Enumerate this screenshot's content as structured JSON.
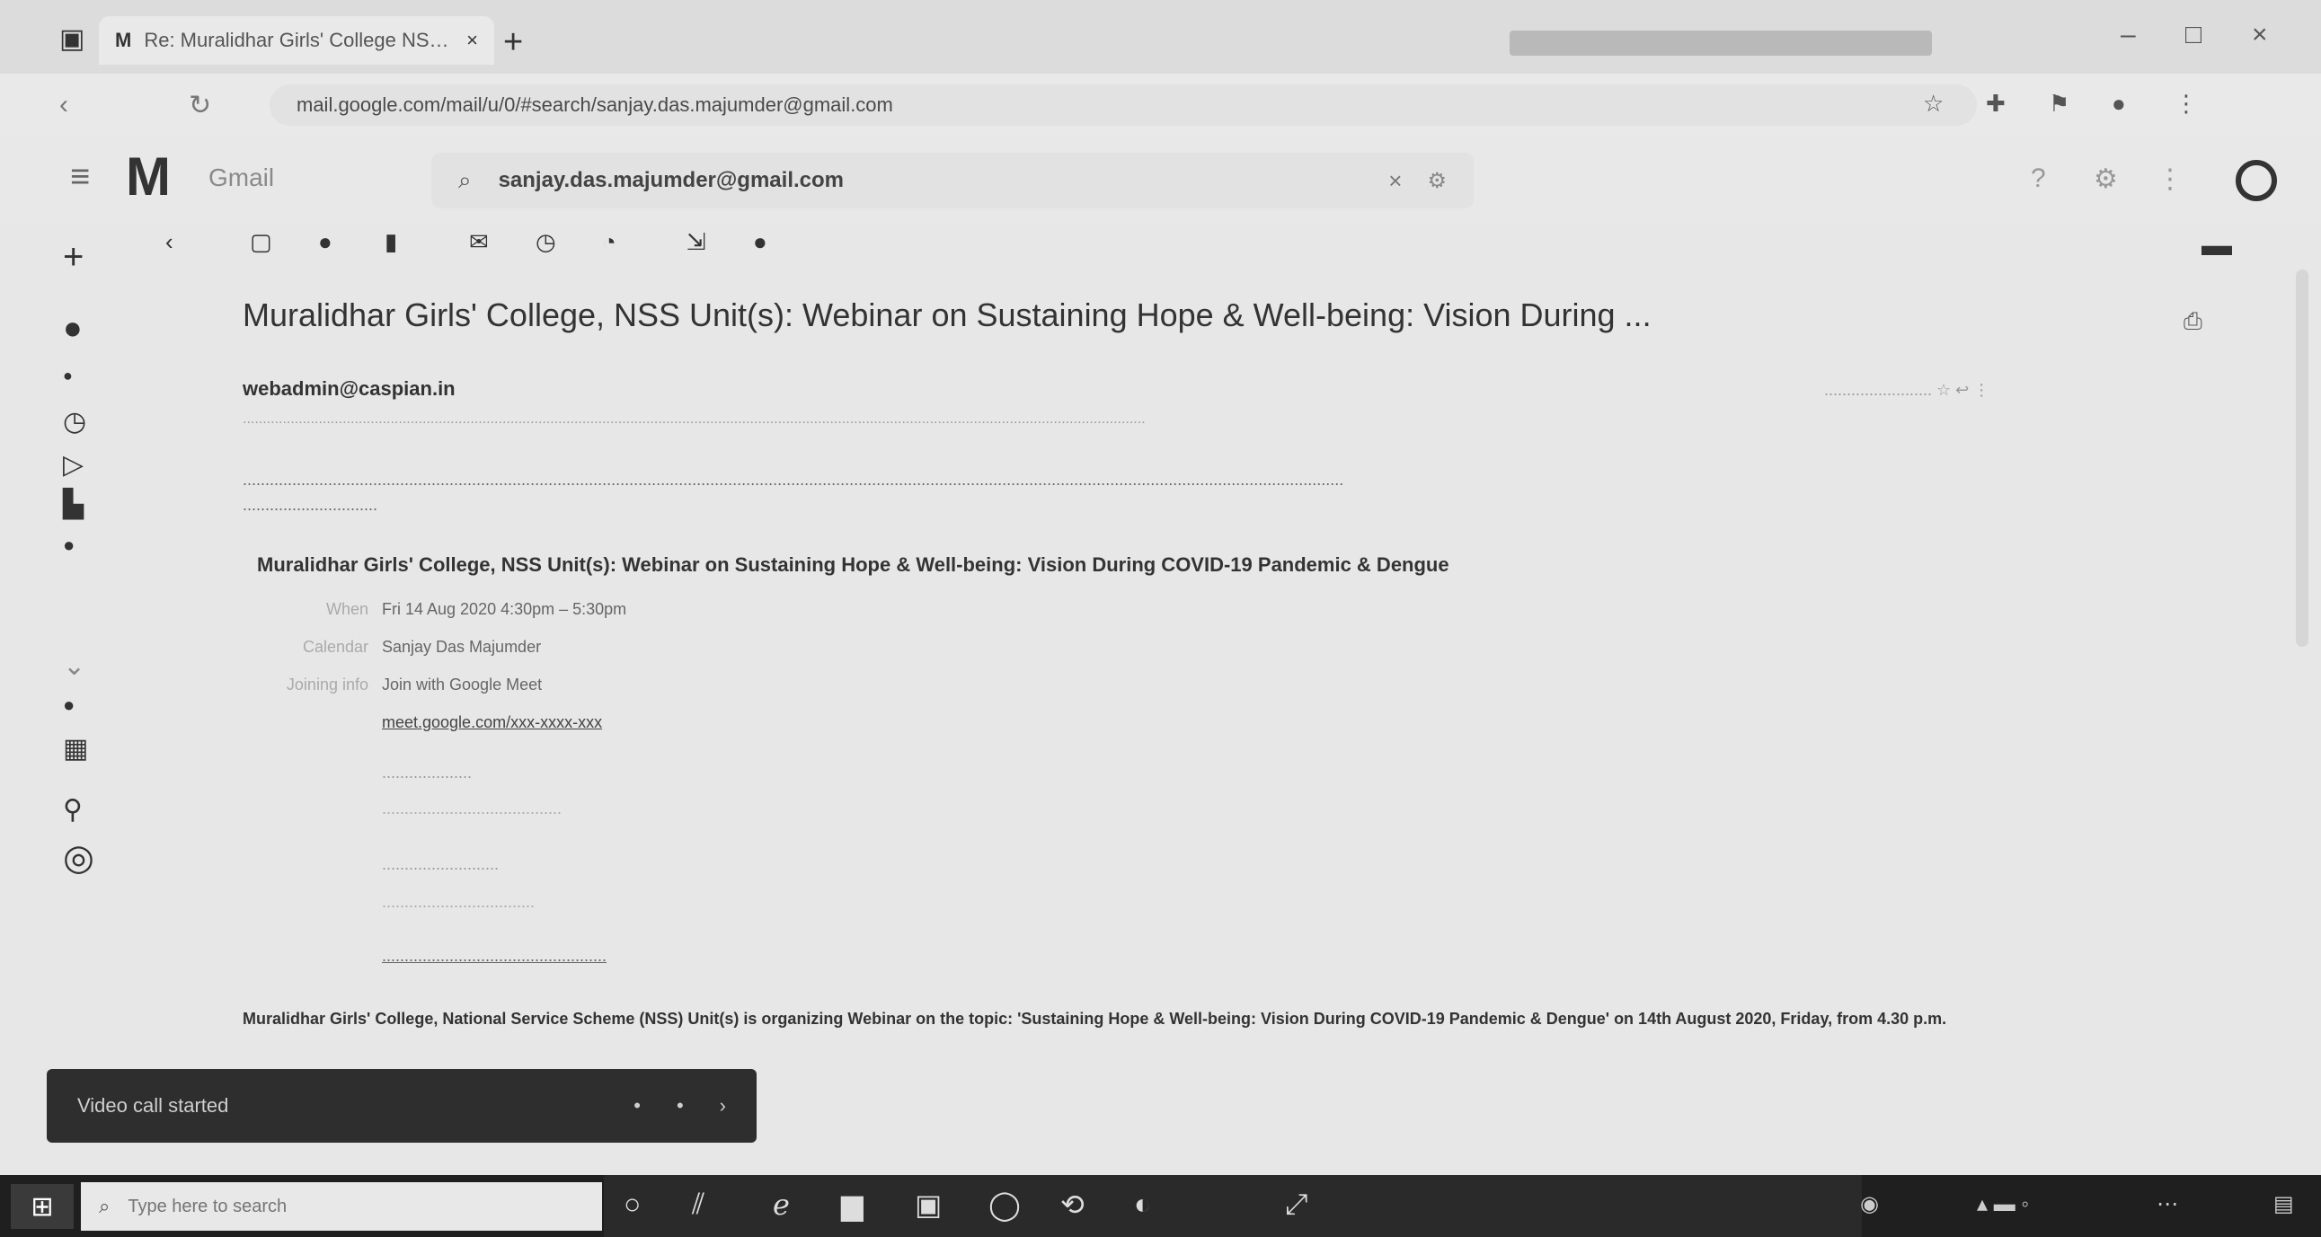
{
  "browser": {
    "tab_title": "Re: Muralidhar Girls' College NSS...",
    "new_tab_glyph": "+",
    "url": "mail.google.com/mail/u/0/#search/sanjay.das.majumder@gmail.com"
  },
  "gmail": {
    "logo_text": "M",
    "product_name": "Gmail",
    "search_value": "sanjay.das.majumder@gmail.com"
  },
  "email": {
    "subject": "Muralidhar Girls' College, NSS Unit(s): Webinar on Sustaining Hope & Well-being: Vision During ...",
    "sender": "webadmin@caspian.in",
    "event_title": "Muralidhar Girls' College, NSS Unit(s): Webinar on Sustaining Hope & Well-being: Vision During COVID-19 Pandemic & Dengue",
    "rows": [
      {
        "label": "When",
        "value": "Fri 14 Aug 2020 4:30pm – 5:30pm"
      },
      {
        "label": "Calendar",
        "value": "Sanjay Das Majumder"
      },
      {
        "label": "Joining info",
        "value": "Join with Google Meet"
      },
      {
        "label": "",
        "value": "meet.google.com/xxx-xxxx-xxx",
        "link": true
      }
    ],
    "footer": "Muralidhar Girls' College, National Service Scheme (NSS) Unit(s) is organizing Webinar on the topic: 'Sustaining Hope & Well-being: Vision During COVID-19 Pandemic & Dengue' on 14th August 2020, Friday, from 4.30 p.m."
  },
  "snackbar": {
    "text": "Video call started"
  },
  "taskbar": {
    "search_placeholder": "Type here to search"
  },
  "colors": {
    "page_bg": "#e7e7e7",
    "taskbar": "#1f1f1f",
    "snackbar": "#2e2e2e"
  }
}
